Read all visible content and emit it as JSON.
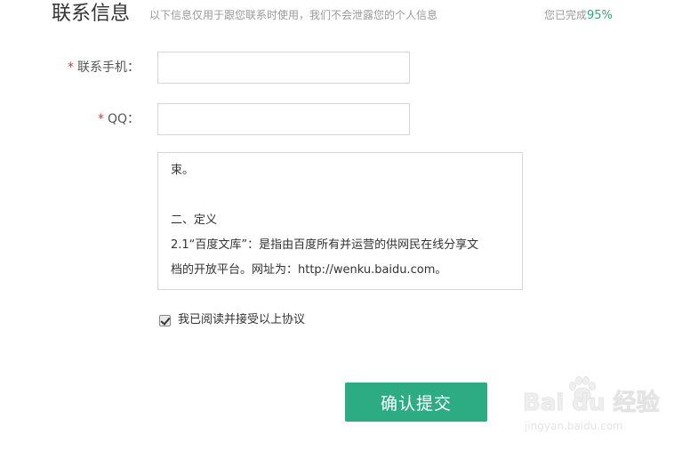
{
  "header": {
    "title": "联系信息",
    "subtitle": "以下信息仅用于跟您联系时使用，我们不会泄露您的个人信息",
    "progress_prefix": "您已完成",
    "progress_value": "95%"
  },
  "form": {
    "required_mark": "*",
    "phone_label": "联系手机：",
    "phone_value": "",
    "qq_label": "QQ：",
    "qq_value": ""
  },
  "agreement": {
    "lines": [
      "束。",
      "",
      "二、定义",
      "2.1“百度文库”：是指由百度所有并运营的供网民在线分享文",
      "档的开放平台。网址为：http://wenku.baidu.com。"
    ]
  },
  "agree_checkbox": {
    "checked": true,
    "label": "我已阅读并接受以上协议"
  },
  "submit": {
    "label": "确认提交"
  },
  "watermark": {
    "logo_text": "Bai du 经验",
    "url": "jingyan.baidu.com"
  },
  "colors": {
    "accent": "#2dab82",
    "required": "#dd3333",
    "muted_text": "#999999",
    "border": "#d6d6d6"
  }
}
